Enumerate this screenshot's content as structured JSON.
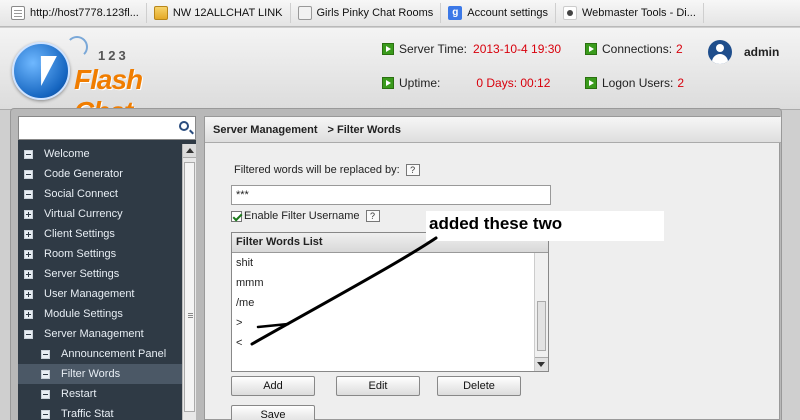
{
  "bookmarks": [
    {
      "label": "http://host7778.123fl...",
      "icon": "page-icon"
    },
    {
      "label": "NW 12ALLCHAT LINK",
      "icon": "folder-icon"
    },
    {
      "label": "Girls Pinky Chat Rooms",
      "icon": "puzzle-icon"
    },
    {
      "label": "Account settings",
      "icon": "google-icon"
    },
    {
      "label": "Webmaster Tools - Di...",
      "icon": "webmaster-icon"
    }
  ],
  "logo": {
    "prefix": "123",
    "name": "Flash Chat"
  },
  "status": {
    "server_time_label": "Server Time:",
    "server_time_value": "2013-10-4 19:30",
    "uptime_label": "Uptime:",
    "uptime_value": "0 Days: 00:12",
    "connections_label": "Connections:",
    "connections_value": "2",
    "logon_label": "Logon Users:",
    "logon_value": "2"
  },
  "user": {
    "name": "admin"
  },
  "sidebar": {
    "items": [
      {
        "label": "Welcome",
        "icon": "minus"
      },
      {
        "label": "Code Generator",
        "icon": "minus"
      },
      {
        "label": "Social Connect",
        "icon": "minus"
      },
      {
        "label": "Virtual Currency",
        "icon": "plus"
      },
      {
        "label": "Client Settings",
        "icon": "plus"
      },
      {
        "label": "Room Settings",
        "icon": "plus"
      },
      {
        "label": "Server Settings",
        "icon": "plus"
      },
      {
        "label": "User Management",
        "icon": "plus"
      },
      {
        "label": "Module Settings",
        "icon": "plus"
      },
      {
        "label": "Server Management",
        "icon": "minus"
      },
      {
        "label": "Announcement Panel",
        "icon": "minus"
      },
      {
        "label": "Filter Words",
        "icon": "minus"
      },
      {
        "label": "Restart",
        "icon": "minus"
      },
      {
        "label": "Traffic Stat",
        "icon": "minus"
      }
    ]
  },
  "breadcrumb": {
    "section": "Server Management",
    "page": "> Filter Words"
  },
  "form": {
    "replace_label": "Filtered words will be replaced by:",
    "help": "?",
    "replace_value": "***",
    "enable_filter_label": "Enable Filter Username",
    "enable_filter_checked": true
  },
  "filter_list": {
    "header": "Filter Words List",
    "items": [
      "shit",
      "mmm",
      "/me",
      ">",
      "<"
    ]
  },
  "buttons": {
    "add": "Add",
    "edit": "Edit",
    "delete": "Delete",
    "save": "Save"
  },
  "annotation": {
    "text": "added these two"
  }
}
